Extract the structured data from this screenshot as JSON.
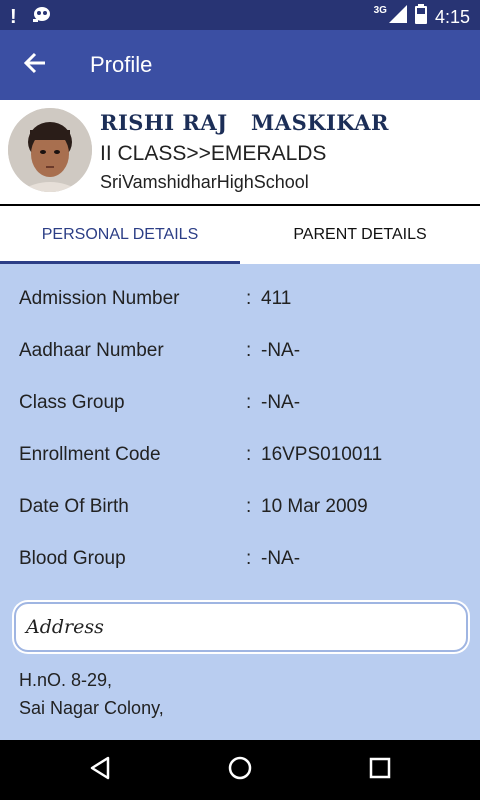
{
  "status_bar": {
    "network": "3G",
    "time": "4:15"
  },
  "app_bar": {
    "title": "Profile"
  },
  "profile": {
    "name": "RISHI RAJ   MASKIKAR",
    "class": "II CLASS>>EMERALDS",
    "school": "SriVamshidharHighSchool"
  },
  "tabs": [
    {
      "label": "PERSONAL DETAILS",
      "active": true
    },
    {
      "label": "PARENT DETAILS",
      "active": false
    }
  ],
  "details": [
    {
      "label": "Admission Number",
      "value": "411"
    },
    {
      "label": "Aadhaar Number",
      "value": "-NA-"
    },
    {
      "label": "Class Group",
      "value": "-NA-"
    },
    {
      "label": "Enrollment Code",
      "value": "16VPS010011"
    },
    {
      "label": "Date Of Birth",
      "value": "10 Mar 2009"
    },
    {
      "label": "Blood Group",
      "value": "-NA-"
    }
  ],
  "address": {
    "title": "Address",
    "lines": [
      "H.nO. 8-29,",
      "Sai Nagar Colony,"
    ]
  },
  "colors": {
    "status_bar": "#283474",
    "app_bar": "#3b4fa3",
    "content_bg": "#b9cdf0",
    "accent": "#2c3e86"
  },
  "icons": {
    "status_left": [
      "exclamation-icon",
      "debug-icon"
    ],
    "status_right": [
      "signal-icon",
      "battery-icon"
    ],
    "back": "arrow-left-icon",
    "nav": [
      "back-triangle-icon",
      "home-circle-icon",
      "recents-square-icon"
    ]
  }
}
